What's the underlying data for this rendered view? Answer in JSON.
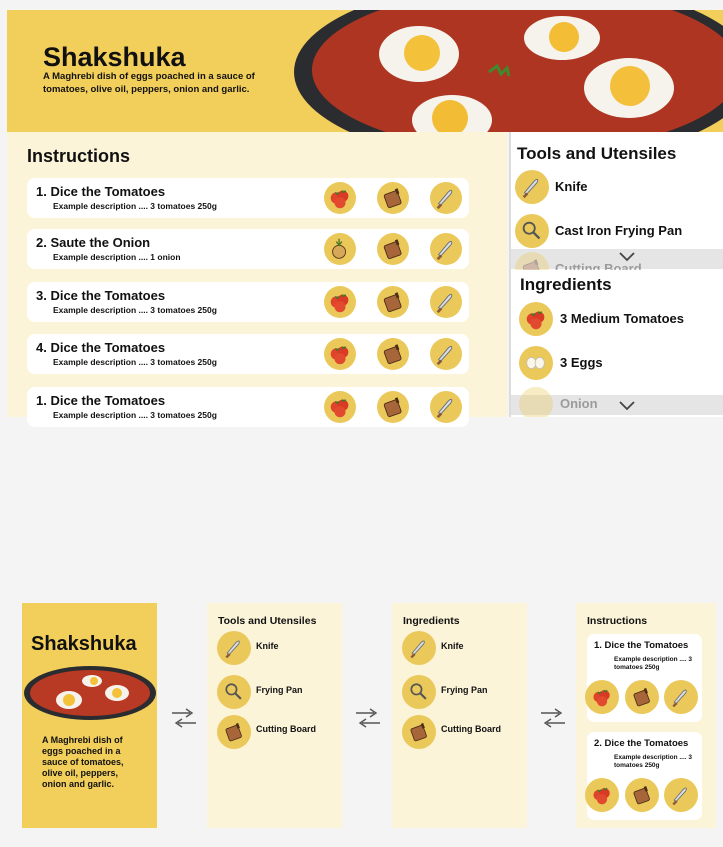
{
  "hero": {
    "title": "Shakshuka",
    "description": "A Maghrebi dish of eggs poached in a sauce of tomatoes, olive oil, peppers, onion and garlic."
  },
  "instructions": {
    "title": "Instructions",
    "steps": [
      {
        "title": "1. Dice the Tomatoes",
        "desc": "Example description .... 3 tomatoes 250g",
        "icons": [
          "tomato-icon",
          "cutting-board-icon",
          "knife-icon"
        ]
      },
      {
        "title": "2. Saute the Onion",
        "desc": "Example description .... 1 onion",
        "icons": [
          "onion-icon",
          "cutting-board-icon",
          "knife-icon"
        ]
      },
      {
        "title": "3. Dice the Tomatoes",
        "desc": "Example description .... 3 tomatoes 250g",
        "icons": [
          "tomato-icon",
          "cutting-board-icon",
          "knife-icon"
        ]
      },
      {
        "title": "4. Dice the Tomatoes",
        "desc": "Example description .... 3 tomatoes 250g",
        "icons": [
          "tomato-icon",
          "cutting-board-icon",
          "knife-icon"
        ]
      },
      {
        "title": "1. Dice the Tomatoes",
        "desc": "Example description .... 3 tomatoes 250g",
        "icons": [
          "tomato-icon",
          "cutting-board-icon",
          "knife-icon"
        ]
      }
    ]
  },
  "tools": {
    "title": "Tools and Utensiles",
    "items": [
      "Knife",
      "Cast Iron Frying Pan",
      "Cutting Board"
    ]
  },
  "ingredients": {
    "title": "Ingredients",
    "items": [
      "3 Medium Tomatoes",
      "3 Eggs",
      "Onion"
    ]
  },
  "mobile": {
    "hero_title": "Shakshuka",
    "hero_desc": "A Maghrebi dish of eggs poached in a sauce of tomatoes, olive oil, peppers, onion and garlic.",
    "tools_title": "Tools and Utensiles",
    "tools_items": [
      "Knife",
      "Frying Pan",
      "Cutting Board"
    ],
    "ingredients_title": "Ingredients",
    "ingredients_items": [
      "Knife",
      "Frying Pan",
      "Cutting Board"
    ],
    "instructions_title": "Instructions",
    "instr_steps": [
      {
        "title": "1. Dice the Tomatoes",
        "desc": "Example description .... 3 tomatoes 250g"
      },
      {
        "title": "2. Dice the Tomatoes",
        "desc": "Example description .... 3 tomatoes 250g"
      }
    ]
  },
  "colors": {
    "accent": "#f2cf5b",
    "icon_bg": "#eac95a",
    "panel": "#fbf4d9",
    "page": "#f4f4f4"
  }
}
